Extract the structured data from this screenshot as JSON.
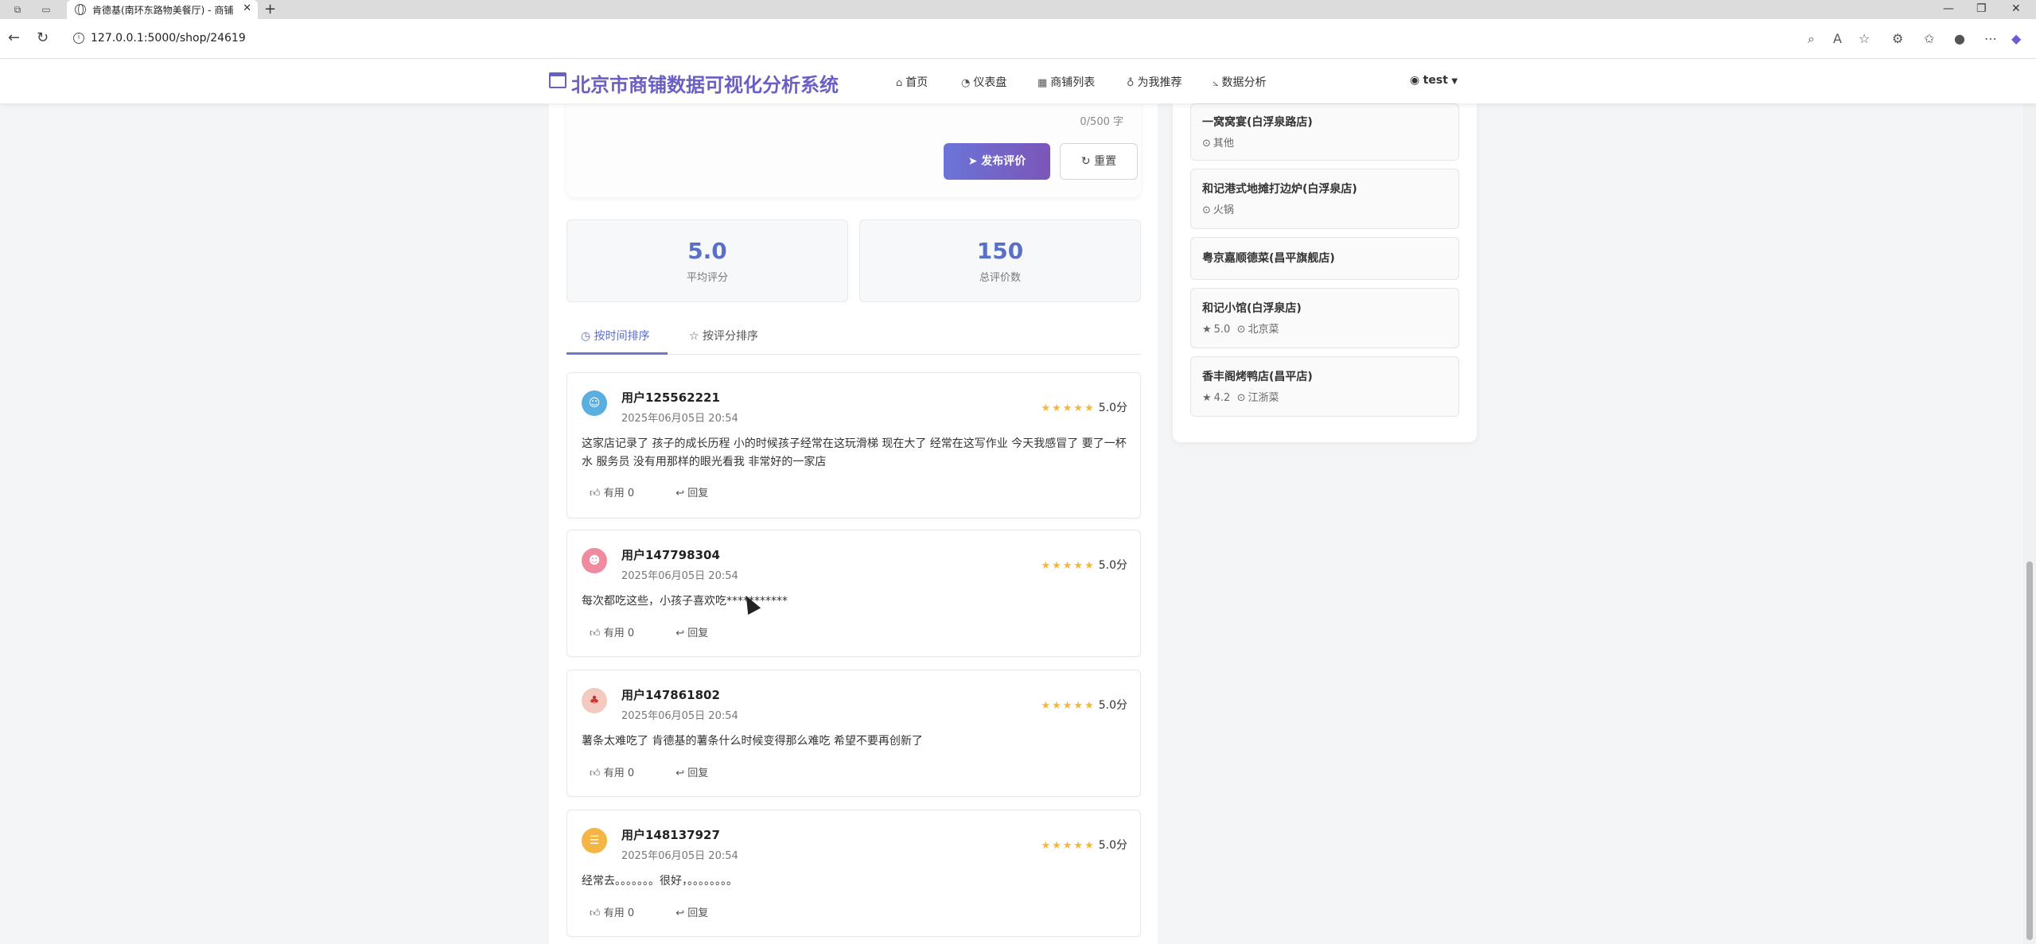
{
  "browser": {
    "tab_title": "肯德基(南环东路物美餐厅) - 商铺",
    "new_tab": "+",
    "url": "127.0.0.1:5000/shop/24619",
    "win_min": "—",
    "win_max": "❐",
    "win_close": "✕"
  },
  "app": {
    "brand": "北京市商铺数据可视化分析系统",
    "nav": [
      {
        "label": "首页",
        "icon": "home-icon"
      },
      {
        "label": "仪表盘",
        "icon": "dashboard-icon"
      },
      {
        "label": "商铺列表",
        "icon": "shop-icon"
      },
      {
        "label": "为我推荐",
        "icon": "lightbulb-icon"
      },
      {
        "label": "数据分析",
        "icon": "chart-icon"
      }
    ],
    "user": "test"
  },
  "compose": {
    "counter": "0/500 字",
    "submit_label": "发布评价",
    "reset_label": "重置"
  },
  "stats": {
    "avg_value": "5.0",
    "avg_label": "平均评分",
    "count_value": "150",
    "count_label": "总评价数"
  },
  "sort": {
    "by_time": "按时间排序",
    "by_rating": "按评分排序"
  },
  "reviews": [
    {
      "user": "用户125562221",
      "time": "2025年06月05日 20:54",
      "stars": "★★★★★",
      "rating": "5.0分",
      "text": "这家店记录了 孩子的成长历程 小的时候孩子经常在这玩滑梯 现在大了 经常在这写作业 今天我感冒了 要了一杯水 服务员 没有用那样的眼光看我 非常好的一家店",
      "useful": "有用 0",
      "reply": "回复",
      "avatar_color": "#5aaee0"
    },
    {
      "user": "用户147798304",
      "time": "2025年06月05日 20:54",
      "stars": "★★★★★",
      "rating": "5.0分",
      "text": "每次都吃这些，小孩子喜欢吃***********",
      "useful": "有用 0",
      "reply": "回复",
      "avatar_color": "#f08aa0"
    },
    {
      "user": "用户147861802",
      "time": "2025年06月05日 20:54",
      "stars": "★★★★★",
      "rating": "5.0分",
      "text": "薯条太难吃了 肯德基的薯条什么时候变得那么难吃 希望不要再创新了",
      "useful": "有用 0",
      "reply": "回复",
      "avatar_color": "#f3c9c0"
    },
    {
      "user": "用户148137927",
      "time": "2025年06月05日 20:54",
      "stars": "★★★★★",
      "rating": "5.0分",
      "text": "经常去。。。。。。。很好，。。。。。。。。",
      "useful": "有用 0",
      "reply": "回复",
      "avatar_color": "#f5b545"
    }
  ],
  "side": [
    {
      "name": "一窝窝宴(白浮泉路店)",
      "rating": "",
      "cuisine": "其他"
    },
    {
      "name": "和记港式地摊打边炉(白浮泉店)",
      "rating": "",
      "cuisine": "火锅"
    },
    {
      "name": "粤京嘉顺德菜(昌平旗舰店)",
      "rating": "",
      "cuisine": ""
    },
    {
      "name": "和记小馆(白浮泉店)",
      "rating": "5.0",
      "cuisine": "北京菜"
    },
    {
      "name": "香丰阁烤鸭店(昌平店)",
      "rating": "4.2",
      "cuisine": "江浙菜"
    }
  ]
}
